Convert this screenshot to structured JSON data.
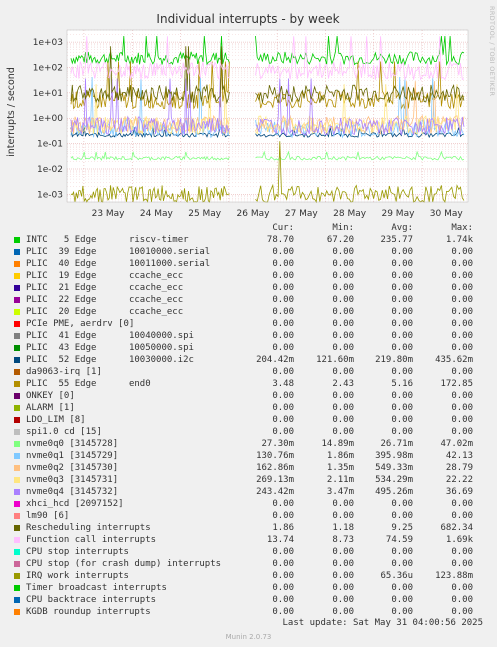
{
  "title": "Individual interrupts - by week",
  "side_text": "RRDTOOL / TOBI OETIKER",
  "footer": "Munin 2.0.73",
  "last_update": "Last update: Sat May 31 04:00:56 2025",
  "legend_headers": {
    "cur": "Cur:",
    "min": "Min:",
    "avg": "Avg:",
    "max": "Max:"
  },
  "chart_data": {
    "type": "line",
    "title": "Individual interrupts - by week",
    "ylabel": "interrupts / second",
    "y_scale": "log",
    "ylim": [
      0.0005,
      3000
    ],
    "y_ticks": [
      "1e+03",
      "1e+02",
      "1e+01",
      "1e+00",
      "1e-01",
      "1e-02",
      "1e-03"
    ],
    "x_ticks": [
      "23 May",
      "24 May",
      "25 May",
      "26 May",
      "27 May",
      "28 May",
      "29 May",
      "30 May"
    ],
    "grid": true,
    "series": [
      {
        "name": "INTC   5 Edge      riscv-timer",
        "color": "#00cc00",
        "cur": "78.70",
        "min": "67.20",
        "avg": "235.77",
        "max": "1.74k"
      },
      {
        "name": "PLIC  39 Edge      10010000.serial",
        "color": "#0066b3",
        "cur": "0.00",
        "min": "0.00",
        "avg": "0.00",
        "max": "0.00"
      },
      {
        "name": "PLIC  40 Edge      10011000.serial",
        "color": "#ff8000",
        "cur": "0.00",
        "min": "0.00",
        "avg": "0.00",
        "max": "0.00"
      },
      {
        "name": "PLIC  19 Edge      ccache_ecc",
        "color": "#ffcc00",
        "cur": "0.00",
        "min": "0.00",
        "avg": "0.00",
        "max": "0.00"
      },
      {
        "name": "PLIC  21 Edge      ccache_ecc",
        "color": "#330099",
        "cur": "0.00",
        "min": "0.00",
        "avg": "0.00",
        "max": "0.00"
      },
      {
        "name": "PLIC  22 Edge      ccache_ecc",
        "color": "#990099",
        "cur": "0.00",
        "min": "0.00",
        "avg": "0.00",
        "max": "0.00"
      },
      {
        "name": "PLIC  20 Edge      ccache_ecc",
        "color": "#ccff00",
        "cur": "0.00",
        "min": "0.00",
        "avg": "0.00",
        "max": "0.00"
      },
      {
        "name": "PCIe PME, aerdrv [0]",
        "color": "#ff0000",
        "cur": "0.00",
        "min": "0.00",
        "avg": "0.00",
        "max": "0.00"
      },
      {
        "name": "PLIC  41 Edge      10040000.spi",
        "color": "#808080",
        "cur": "0.00",
        "min": "0.00",
        "avg": "0.00",
        "max": "0.00"
      },
      {
        "name": "PLIC  43 Edge      10050000.spi",
        "color": "#008f00",
        "cur": "0.00",
        "min": "0.00",
        "avg": "0.00",
        "max": "0.00"
      },
      {
        "name": "PLIC  52 Edge      10030000.i2c",
        "color": "#00487d",
        "cur": "204.42m",
        "min": "121.60m",
        "avg": "219.80m",
        "max": "435.62m"
      },
      {
        "name": "da9063-irq [1]",
        "color": "#b35a00",
        "cur": "0.00",
        "min": "0.00",
        "avg": "0.00",
        "max": "0.00"
      },
      {
        "name": "PLIC  55 Edge      end0",
        "color": "#b38f00",
        "cur": "3.48",
        "min": "2.43",
        "avg": "5.16",
        "max": "172.85"
      },
      {
        "name": "ONKEY [0]",
        "color": "#6b006b",
        "cur": "0.00",
        "min": "0.00",
        "avg": "0.00",
        "max": "0.00"
      },
      {
        "name": "ALARM [1]",
        "color": "#8fb300",
        "cur": "0.00",
        "min": "0.00",
        "avg": "0.00",
        "max": "0.00"
      },
      {
        "name": "LDO_LIM [8]",
        "color": "#b30000",
        "cur": "0.00",
        "min": "0.00",
        "avg": "0.00",
        "max": "0.00"
      },
      {
        "name": "spi1.0 cd [15]",
        "color": "#bebebe",
        "cur": "0.00",
        "min": "0.00",
        "avg": "0.00",
        "max": "0.00"
      },
      {
        "name": "nvme0q0 [3145728]",
        "color": "#80ff80",
        "cur": "27.30m",
        "min": "14.89m",
        "avg": "26.71m",
        "max": "47.02m"
      },
      {
        "name": "nvme0q1 [3145729]",
        "color": "#80c9ff",
        "cur": "130.76m",
        "min": "1.86m",
        "avg": "395.98m",
        "max": "42.13"
      },
      {
        "name": "nvme0q2 [3145730]",
        "color": "#ffc080",
        "cur": "162.86m",
        "min": "1.35m",
        "avg": "549.33m",
        "max": "28.79"
      },
      {
        "name": "nvme0q3 [3145731]",
        "color": "#ffe680",
        "cur": "269.13m",
        "min": "2.11m",
        "avg": "534.29m",
        "max": "22.22"
      },
      {
        "name": "nvme0q4 [3145732]",
        "color": "#aa80ff",
        "cur": "243.42m",
        "min": "3.47m",
        "avg": "495.26m",
        "max": "36.69"
      },
      {
        "name": "xhci_hcd [2097152]",
        "color": "#ee00cc",
        "cur": "0.00",
        "min": "0.00",
        "avg": "0.00",
        "max": "0.00"
      },
      {
        "name": "lm90 [6]",
        "color": "#ff8080",
        "cur": "0.00",
        "min": "0.00",
        "avg": "0.00",
        "max": "0.00"
      },
      {
        "name": "Rescheduling interrupts",
        "color": "#666600",
        "cur": "1.86",
        "min": "1.18",
        "avg": "9.25",
        "max": "682.34"
      },
      {
        "name": "Function call interrupts",
        "color": "#ffbfff",
        "cur": "13.74",
        "min": "8.73",
        "avg": "74.59",
        "max": "1.69k"
      },
      {
        "name": "CPU stop interrupts",
        "color": "#00ffcc",
        "cur": "0.00",
        "min": "0.00",
        "avg": "0.00",
        "max": "0.00"
      },
      {
        "name": "CPU stop (for crash dump) interrupts",
        "color": "#cc6699",
        "cur": "0.00",
        "min": "0.00",
        "avg": "0.00",
        "max": "0.00"
      },
      {
        "name": "IRQ work interrupts",
        "color": "#999900",
        "cur": "0.00",
        "min": "0.00",
        "avg": "65.36u",
        "max": "123.88m"
      },
      {
        "name": "Timer broadcast interrupts",
        "color": "#00cc00",
        "cur": "0.00",
        "min": "0.00",
        "avg": "0.00",
        "max": "0.00"
      },
      {
        "name": "CPU backtrace interrupts",
        "color": "#0066b3",
        "cur": "0.00",
        "min": "0.00",
        "avg": "0.00",
        "max": "0.00"
      },
      {
        "name": "KGDB roundup interrupts",
        "color": "#ff8000",
        "cur": "0.00",
        "min": "0.00",
        "avg": "0.00",
        "max": "0.00"
      }
    ]
  }
}
